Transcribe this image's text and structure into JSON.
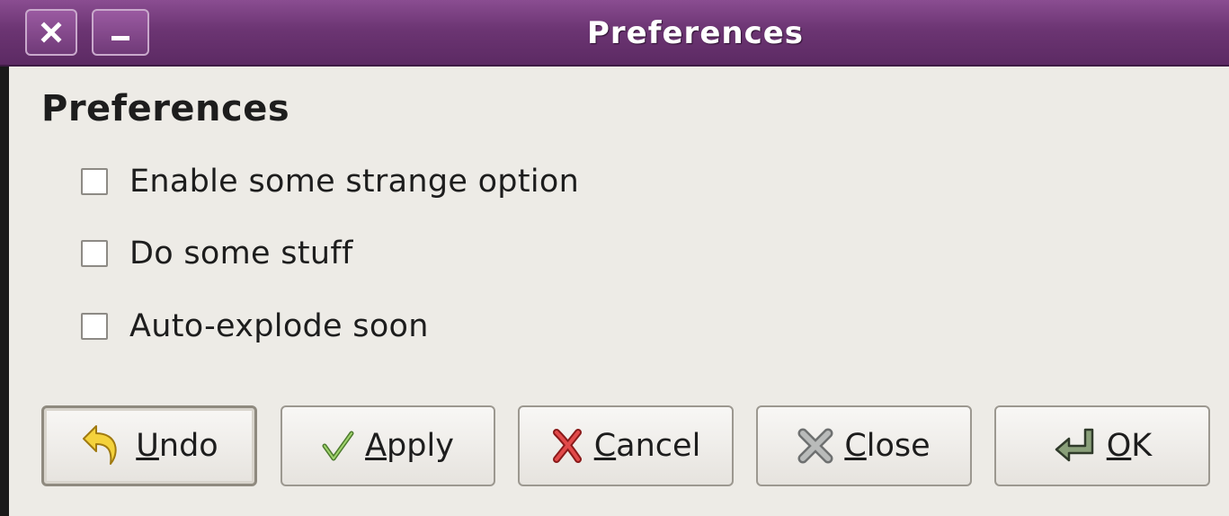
{
  "window": {
    "title": "Preferences",
    "close_icon": "close-icon",
    "minimize_icon": "minimize-icon",
    "titlebar_color": "#6c3573"
  },
  "content": {
    "heading": "Preferences",
    "options": [
      {
        "label": "Enable some strange option",
        "checked": false
      },
      {
        "label": "Do some stuff",
        "checked": false
      },
      {
        "label": "Auto-explode soon",
        "checked": false
      }
    ]
  },
  "buttons": {
    "undo": {
      "mnemonic": "U",
      "rest": "ndo",
      "icon": "undo-arrow-icon"
    },
    "apply": {
      "mnemonic": "A",
      "rest": "pply",
      "icon": "checkmark-icon"
    },
    "cancel": {
      "mnemonic": "C",
      "rest": "ancel",
      "icon": "red-x-icon"
    },
    "close": {
      "mnemonic": "C",
      "rest": "lose",
      "icon": "gray-x-icon"
    },
    "ok": {
      "mnemonic": "O",
      "rest": "K",
      "icon": "enter-arrow-icon"
    }
  }
}
